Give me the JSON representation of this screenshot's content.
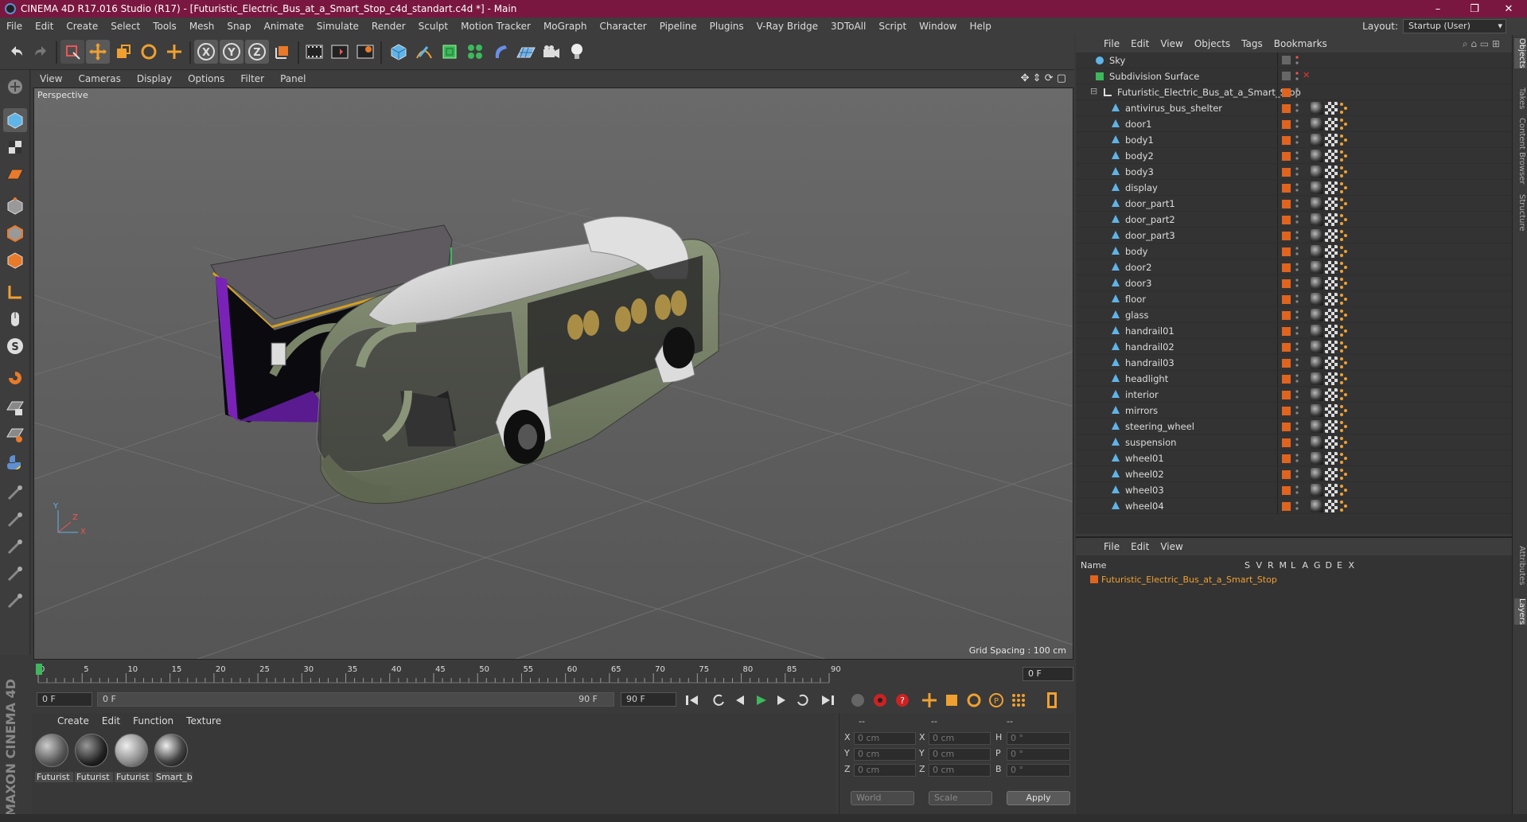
{
  "window": {
    "title": "CINEMA 4D R17.016 Studio (R17) - [Futuristic_Electric_Bus_at_a_Smart_Stop_c4d_standart.c4d *] - Main",
    "minimize": "–",
    "maximize": "❐",
    "close": "✕"
  },
  "menubar": {
    "items": [
      "File",
      "Edit",
      "Create",
      "Select",
      "Tools",
      "Mesh",
      "Snap",
      "Animate",
      "Simulate",
      "Render",
      "Sculpt",
      "Motion Tracker",
      "MoGraph",
      "Character",
      "Pipeline",
      "Plugins",
      "V-Ray Bridge",
      "3DToAll",
      "Script",
      "Window",
      "Help"
    ],
    "layout_label": "Layout:",
    "layout_value": "Startup (User)"
  },
  "viewport": {
    "menu": [
      "View",
      "Cameras",
      "Display",
      "Options",
      "Filter",
      "Panel"
    ],
    "label": "Perspective",
    "grid_spacing": "Grid Spacing : 100 cm",
    "axis_y": "Y",
    "axis_z": "Z",
    "axis_x": "X"
  },
  "timeline": {
    "ticks": [
      "0",
      "5",
      "10",
      "15",
      "20",
      "25",
      "30",
      "35",
      "40",
      "45",
      "50",
      "55",
      "60",
      "65",
      "70",
      "75",
      "80",
      "85",
      "90"
    ],
    "frame_end_field": "0 F",
    "start_field": "0 F",
    "range_start": "0 F",
    "range_end": "90 F",
    "end_field": "90 F"
  },
  "materials": {
    "menu": [
      "Create",
      "Edit",
      "Function",
      "Texture"
    ],
    "items": [
      "Futurist",
      "Futurist",
      "Futurist",
      "Smart_b"
    ]
  },
  "coords": {
    "headers": [
      "--",
      "--",
      "--"
    ],
    "rows": [
      {
        "a": "X",
        "av": "0 cm",
        "b": "X",
        "bv": "0 cm",
        "c": "H",
        "cv": "0 °"
      },
      {
        "a": "Y",
        "av": "0 cm",
        "b": "Y",
        "bv": "0 cm",
        "c": "P",
        "cv": "0 °"
      },
      {
        "a": "Z",
        "av": "0 cm",
        "b": "Z",
        "bv": "0 cm",
        "c": "B",
        "cv": "0 °"
      }
    ],
    "world": "World",
    "scale": "Scale",
    "apply": "Apply"
  },
  "object_manager": {
    "menu": [
      "File",
      "Edit",
      "View",
      "Objects",
      "Tags",
      "Bookmarks"
    ],
    "objects": [
      {
        "name": "Sky",
        "indent": 0
      },
      {
        "name": "Subdivision Surface",
        "indent": 0
      },
      {
        "name": "Futuristic_Electric_Bus_at_a_Smart_Stop",
        "indent": 1
      },
      {
        "name": "antivirus_bus_shelter",
        "indent": 2
      },
      {
        "name": "door1",
        "indent": 2
      },
      {
        "name": "body1",
        "indent": 2
      },
      {
        "name": "body2",
        "indent": 2
      },
      {
        "name": "body3",
        "indent": 2
      },
      {
        "name": "display",
        "indent": 2
      },
      {
        "name": "door_part1",
        "indent": 2
      },
      {
        "name": "door_part2",
        "indent": 2
      },
      {
        "name": "door_part3",
        "indent": 2
      },
      {
        "name": "body",
        "indent": 2
      },
      {
        "name": "door2",
        "indent": 2
      },
      {
        "name": "door3",
        "indent": 2
      },
      {
        "name": "floor",
        "indent": 2
      },
      {
        "name": "glass",
        "indent": 2
      },
      {
        "name": "handrail01",
        "indent": 2
      },
      {
        "name": "handrail02",
        "indent": 2
      },
      {
        "name": "handrail03",
        "indent": 2
      },
      {
        "name": "headlight",
        "indent": 2
      },
      {
        "name": "interior",
        "indent": 2
      },
      {
        "name": "mirrors",
        "indent": 2
      },
      {
        "name": "steering_wheel",
        "indent": 2
      },
      {
        "name": "suspension",
        "indent": 2
      },
      {
        "name": "wheel01",
        "indent": 2
      },
      {
        "name": "wheel02",
        "indent": 2
      },
      {
        "name": "wheel03",
        "indent": 2
      },
      {
        "name": "wheel04",
        "indent": 2
      }
    ]
  },
  "layers": {
    "menu": [
      "File",
      "Edit",
      "View"
    ],
    "name_header": "Name",
    "col_headers": [
      "S",
      "V",
      "R",
      "M",
      "L",
      "A",
      "G",
      "D",
      "E",
      "X"
    ],
    "layer_name": "Futuristic_Electric_Bus_at_a_Smart_Stop",
    "layer_color": "#e0641e"
  },
  "right_tabs": [
    "Objects",
    "Takes",
    "Content Browser",
    "Structure",
    "Attributes",
    "Layers"
  ],
  "brand": "MAXON CINEMA 4D"
}
